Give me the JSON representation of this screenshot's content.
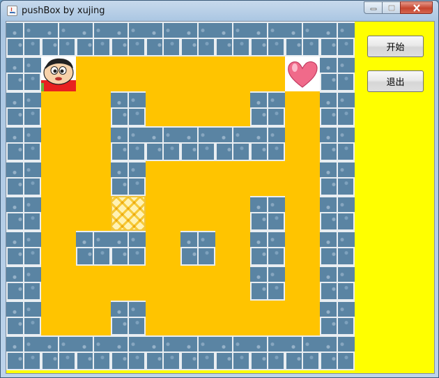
{
  "window": {
    "title": "pushBox by xujing",
    "app_icon": "java-icon",
    "controls": [
      "minimize-icon",
      "maximize-icon",
      "close-icon"
    ]
  },
  "game": {
    "rows": 10,
    "cols": 10,
    "legend": {
      "W": "wall",
      ".": "floor",
      "B": "box",
      "P": "player",
      "H": "goal-heart"
    },
    "grid": [
      "WWWWWWWWWW",
      "WP......HW",
      "W..W...W.W",
      "W..WWWWW.W",
      "W..W.....W",
      "W..B...W.W",
      "W.WW.W.W.W",
      "W......W.W",
      "W..W.....W",
      "WWWWWWWWWW"
    ]
  },
  "sidebar": {
    "start_label": "开始",
    "exit_label": "退出"
  },
  "colors": {
    "floor": "#ffc400",
    "sidebar": "#ffff00",
    "wall": "#5a84a3",
    "heart": "#f06a8a"
  }
}
